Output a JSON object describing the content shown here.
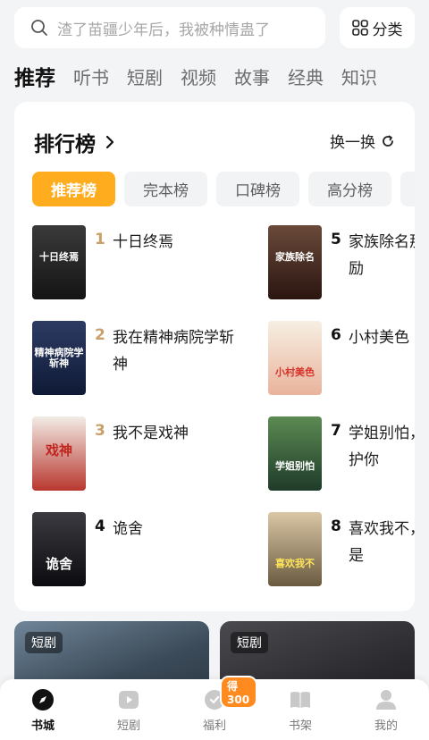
{
  "search": {
    "placeholder": "渣了苗疆少年后，我被种情蛊了"
  },
  "category_button": {
    "label": "分类",
    "icon": "grid-icon"
  },
  "tabs": [
    "推荐",
    "听书",
    "短剧",
    "视频",
    "故事",
    "经典",
    "知识"
  ],
  "active_tab": "推荐",
  "ranking": {
    "title": "排行榜",
    "refresh_label": "换一换",
    "chips": [
      "推荐榜",
      "完本榜",
      "口碑榜",
      "高分榜"
    ],
    "active_chip": "推荐榜",
    "books": [
      {
        "rank": "1",
        "title": "十日终焉",
        "cover_text": "十日终焉"
      },
      {
        "rank": "2",
        "title": "我在精神病院学斩神",
        "cover_text": "精神病院学斩神"
      },
      {
        "rank": "3",
        "title": "我不是戏神",
        "cover_text": "戏神"
      },
      {
        "rank": "4",
        "title": "诡舍",
        "cover_text": "诡舍"
      },
      {
        "rank": "5",
        "title": "家族除名那天，奖励",
        "cover_text": "家族除名"
      },
      {
        "rank": "6",
        "title": "小村美色",
        "cover_text": "小村美色"
      },
      {
        "rank": "7",
        "title": "学姐别怕，我来保护你",
        "cover_text": "学姐别怕"
      },
      {
        "rank": "8",
        "title": "喜欢我不，得亏我是",
        "cover_text": "喜欢我不"
      }
    ]
  },
  "drama_cards": [
    {
      "tag": "短剧"
    },
    {
      "tag": "短剧"
    }
  ],
  "bottom_nav": {
    "items": [
      {
        "label": "书城",
        "icon": "compass-icon"
      },
      {
        "label": "短剧",
        "icon": "play-icon"
      },
      {
        "label": "福利",
        "icon": "gift-icon"
      },
      {
        "label": "书架",
        "icon": "bookshelf-icon"
      },
      {
        "label": "我的",
        "icon": "profile-icon"
      }
    ],
    "active": "书城",
    "welfare_badge": "得300"
  },
  "colors": {
    "accent": "#ffad1f",
    "rank_top": "#c9a06a",
    "badge": "#ff8a1f",
    "background": "#f3f4f6"
  }
}
